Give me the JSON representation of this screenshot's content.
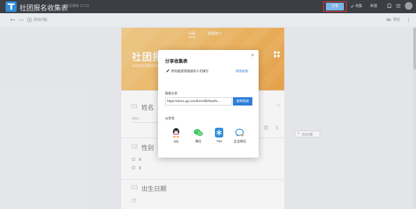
{
  "header": {
    "doc_title": "社团报名收集表",
    "doc_meta": "最近保存 17:13",
    "share_label": "分享",
    "collect_label": "收集",
    "new_label": "新建"
  },
  "toolbar": {
    "add_question_label": "添加问题",
    "preview_label": "预览"
  },
  "form": {
    "tabs": [
      {
        "label": "问题"
      },
      {
        "label": "数据统计"
      }
    ],
    "hero_title": "社团报",
    "hero_sub": "欢迎同学们踊跃报名加入社团，请填写以下信息，我们会尽快与你联系",
    "questions": [
      {
        "num": "01",
        "label": "姓名",
        "hint": "请输入"
      },
      {
        "num": "02",
        "label": "性别",
        "options": [
          "男",
          "女"
        ]
      },
      {
        "num": "03",
        "label": "出生日期"
      }
    ],
    "side_add_label": "添加问题"
  },
  "dialog": {
    "title": "分享收集表",
    "close_glyph": "×",
    "permission_text": "所有能获得链接的人可填写",
    "permission_link": "修改权限",
    "link_section_label": "链接分享",
    "link_value": "https://docs.qq.com/form/fill/Da3f1...",
    "copy_label": "复制链接",
    "share_to_label": "分享到",
    "targets": [
      {
        "label": "QQ",
        "icon": "qq-icon",
        "color": "#1d1d1d"
      },
      {
        "label": "微信",
        "icon": "wechat-icon",
        "color": "#37c45a"
      },
      {
        "label": "TIM",
        "icon": "tim-icon",
        "color": "#2f8ddc"
      },
      {
        "label": "企业微信",
        "icon": "wework-icon",
        "color": "#2f8ddc"
      }
    ]
  },
  "colors": {
    "header_bg": "#3b3f45",
    "accent": "#2f7ddc",
    "hero": "#f3b75f",
    "highlight": "#e0342f"
  }
}
